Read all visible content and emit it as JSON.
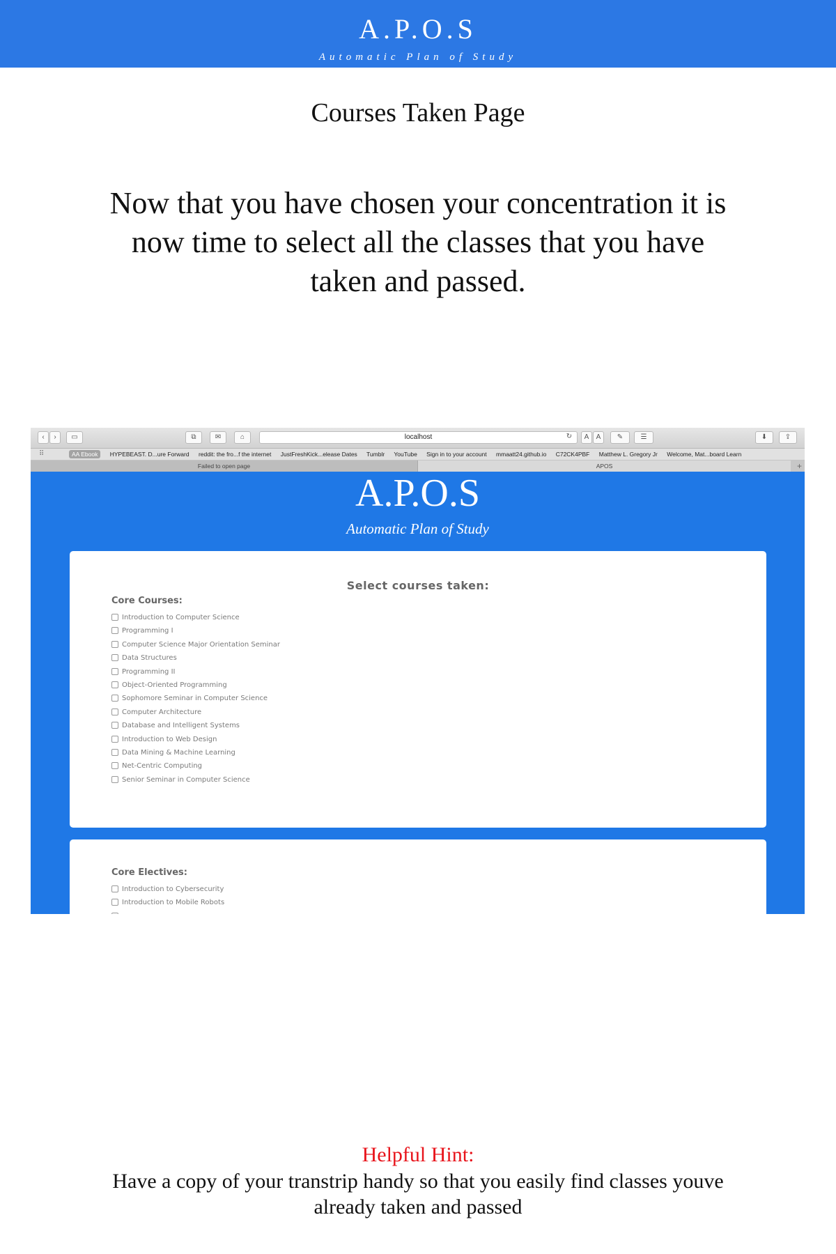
{
  "header": {
    "logo": "A.P.O.S",
    "tagline": "Automatic Plan of Study"
  },
  "page_title": "Courses Taken Page",
  "intro": "Now that you have chosen your concentration it is now time to select all the classes that you have taken and passed.",
  "screenshot": {
    "toolbar": {
      "back": "‹",
      "forward": "›",
      "sidebar": "▭",
      "tabs": "⧉",
      "mail": "✉",
      "home": "⌂",
      "url": "localhost",
      "reload": "↻",
      "font_small": "A",
      "font_large": "A",
      "pen": "✎",
      "reader": "☰",
      "download": "⬇",
      "share": "⇪"
    },
    "bookmarks": [
      "AA Ebook",
      "HYPEBEAST. D...ure Forward",
      "reddit: the fro...f the internet",
      "JustFreshKick...elease Dates",
      "Tumblr",
      "YouTube",
      "Sign in to your account",
      "mmaatt24.github.io",
      "C72CK4PBF",
      "Matthew L. Gregory Jr",
      "Welcome, Mat...board Learn"
    ],
    "tabs": [
      "Failed to open page",
      "APOS"
    ],
    "tab_add": "+",
    "app": {
      "logo": "A.P.O.S",
      "tagline": "Automatic Plan of Study",
      "card_title": "Select courses taken:",
      "core_label": "Core Courses:",
      "core_courses": [
        "Introduction to Computer Science",
        "Programming I",
        "Computer Science Major Orientation Seminar",
        "Data Structures",
        "Programming II",
        "Object-Oriented Programming",
        "Sophomore Seminar in Computer Science",
        "Computer Architecture",
        "Database and Intelligent Systems",
        "Introduction to Web Design",
        "Data Mining & Machine Learning",
        "Net-Centric Computing",
        "Senior Seminar in Computer Science"
      ],
      "electives_label": "Core Electives:",
      "core_electives": [
        "Introduction to Cybersecurity",
        "Introduction to Mobile Robots"
      ]
    }
  },
  "hint": {
    "title": "Helpful Hint:",
    "text": "Have a copy of your transtrip handy so that you easily find classes youve already taken and passed"
  }
}
